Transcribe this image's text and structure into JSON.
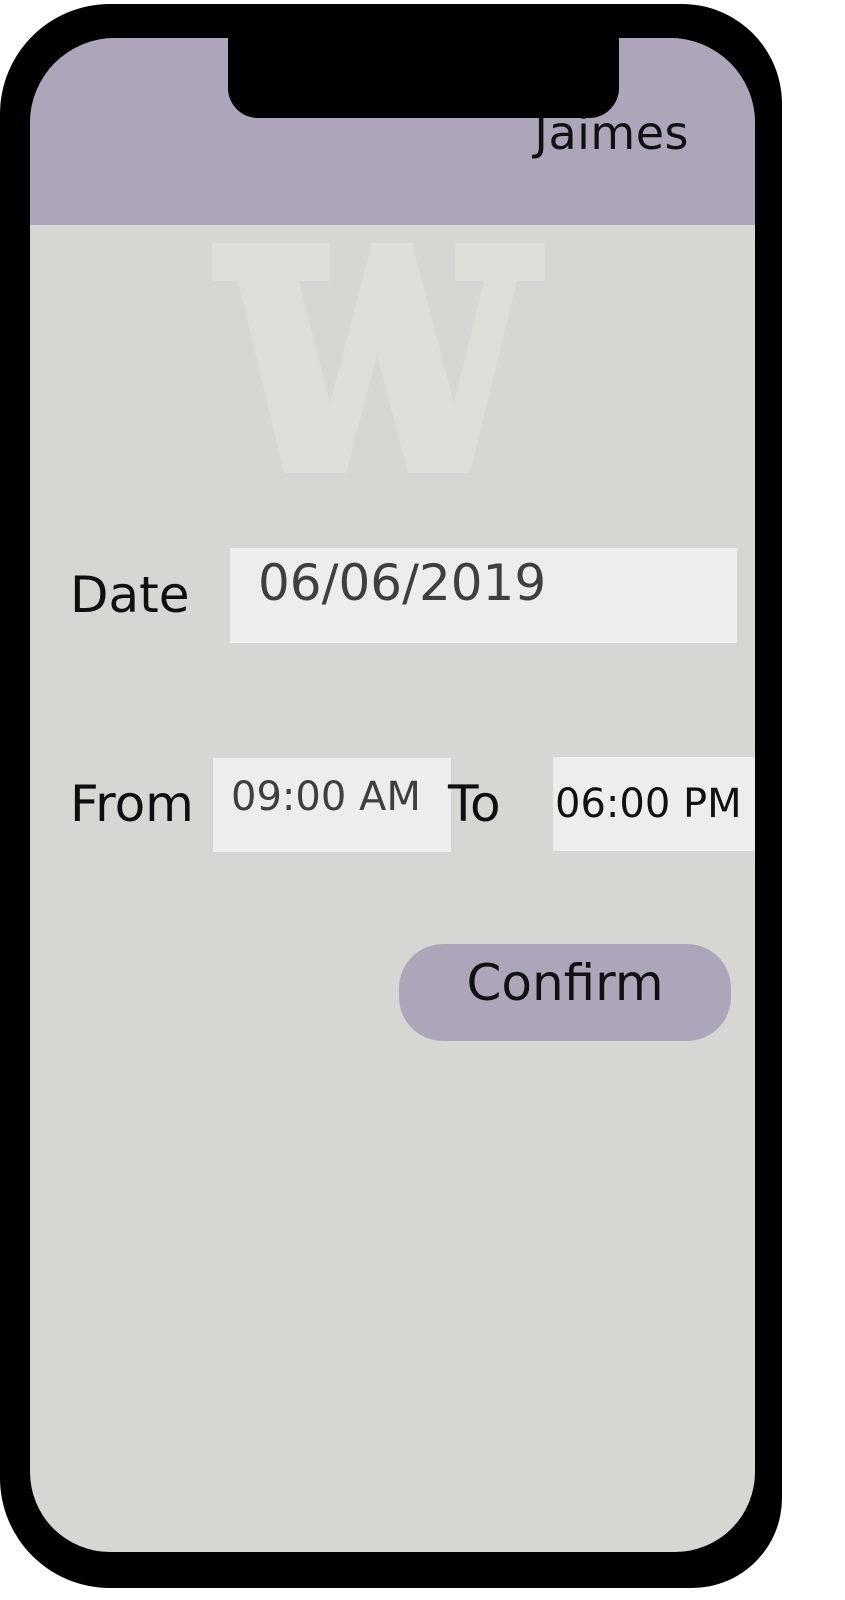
{
  "header": {
    "user_name": "Jaimes"
  },
  "watermark": {
    "letter": "W"
  },
  "form": {
    "date_label": "Date",
    "date_value": "06/06/2019",
    "from_label": "From",
    "from_value": "09:00 AM",
    "to_label": "To",
    "to_value": "06:00 PM",
    "confirm_label": "Confirm"
  },
  "colors": {
    "accent": "#ada6bb",
    "background": "#d6d6d2",
    "input_background": "#ededeb",
    "frame": "#000000"
  }
}
